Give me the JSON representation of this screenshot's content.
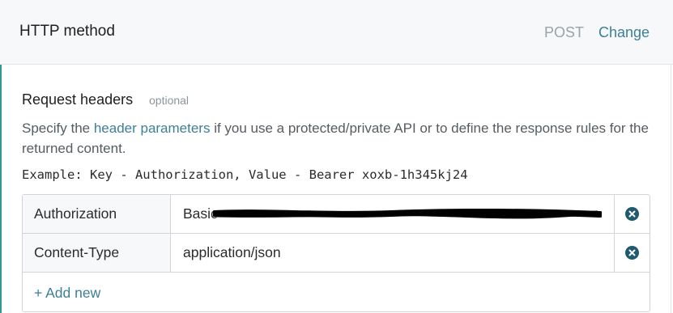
{
  "top_bar": {
    "title": "HTTP method",
    "method": "POST",
    "change_label": "Change"
  },
  "request_headers": {
    "title": "Request headers",
    "optional_label": "optional",
    "description_before": "Specify the ",
    "description_link": "header parameters",
    "description_after": " if you use a protected/private API or to define the response rules for the returned content.",
    "example": "Example: Key - Authorization, Value - Bearer xoxb-1h345kj24",
    "rows": [
      {
        "key": "Authorization",
        "value": "Basic"
      },
      {
        "key": "Content-Type",
        "value": "application/json"
      }
    ],
    "add_new_label": "+ Add new"
  },
  "colors": {
    "accent": "#3e7f96",
    "left_border": "#2f9a93",
    "remove_icon": "#1f5a6e"
  }
}
